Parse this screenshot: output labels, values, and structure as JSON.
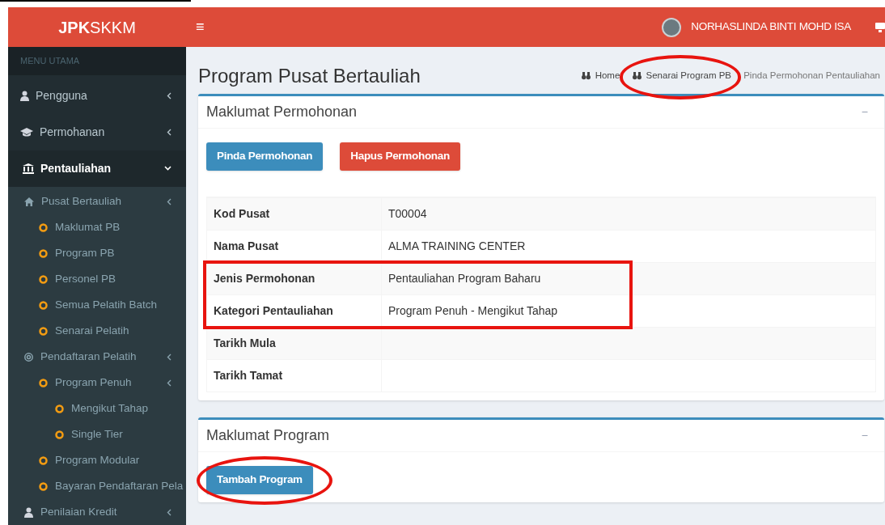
{
  "header": {
    "logo_bold": "JPK",
    "logo_rest": "SKKM",
    "menu_glyph": "≡",
    "user_name": "NORHASLINDA BINTI MOHD ISA"
  },
  "sidebar": {
    "heading": "MENU UTAMA",
    "items": [
      {
        "label": "Pengguna",
        "selected": false,
        "expanded": false
      },
      {
        "label": "Permohanan",
        "selected": false,
        "expanded": false
      },
      {
        "label": "Pentauliahan",
        "selected": true,
        "expanded": true,
        "children": [
          {
            "label": "Pusat Bertauliah",
            "expanded": false,
            "children": [
              {
                "label": "Maklumat PB"
              },
              {
                "label": "Program PB"
              },
              {
                "label": "Personel PB"
              },
              {
                "label": "Semua Pelatih Batch"
              },
              {
                "label": "Senarai Pelatih"
              }
            ]
          },
          {
            "label": "Pendaftaran Pelatih",
            "expanded": false,
            "children": [
              {
                "label": "Program Penuh",
                "expanded": false,
                "children": [
                  {
                    "label": "Mengikut Tahap"
                  },
                  {
                    "label": "Single Tier"
                  }
                ]
              },
              {
                "label": "Program Modular"
              },
              {
                "label": "Bayaran Pendaftaran Pela"
              }
            ]
          },
          {
            "label": "Penilaian Kredit",
            "expanded": false
          }
        ]
      }
    ]
  },
  "page": {
    "title": "Program Pusat Bertauliah",
    "breadcrumb": [
      {
        "label": "Home",
        "circled": false,
        "current": false
      },
      {
        "label": "Senarai Program PB",
        "circled": true,
        "current": false
      },
      {
        "label": "Pinda Permohonan Pentauliahan",
        "circled": false,
        "current": true
      }
    ]
  },
  "boxes": [
    {
      "title": "Maklumat Permohonan",
      "collapse_glyph": "−",
      "buttons": [
        {
          "label": "Pinda Permohonan",
          "color": "#3c8dbc",
          "circled": false
        },
        {
          "label": "Hapus Permohonan",
          "color": "#dd4b39",
          "circled": false
        }
      ],
      "rows": [
        {
          "label": "Kod Pusat",
          "value": "T00004",
          "boxed": false
        },
        {
          "label": "Nama Pusat",
          "value": "ALMA TRAINING CENTER",
          "boxed": false
        },
        {
          "label": "Jenis Permohonan",
          "value": "Pentauliahan Program Baharu",
          "boxed": true
        },
        {
          "label": "Kategori Pentauliahan",
          "value": "Program Penuh - Mengikut Tahap",
          "boxed": true
        },
        {
          "label": "Tarikh Mula",
          "boxed": false
        },
        {
          "label": "Tarikh Tamat",
          "boxed": false
        }
      ]
    },
    {
      "title": "Maklumat Program",
      "collapse_glyph": "−",
      "buttons": [
        {
          "label": "Tambah Program",
          "color": "#3c8dbc",
          "circled": true
        }
      ]
    }
  ]
}
